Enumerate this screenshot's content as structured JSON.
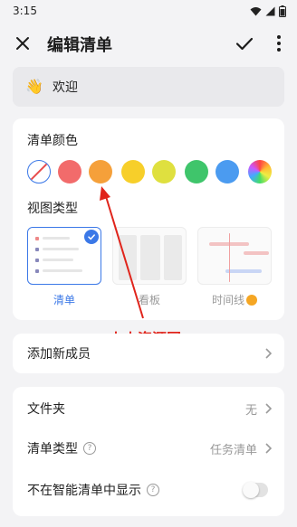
{
  "status_bar": {
    "time": "3:15"
  },
  "app_bar": {
    "title": "编辑清单"
  },
  "name_field": {
    "emoji": "👋",
    "value": "欢迎"
  },
  "colors": {
    "label": "清单颜色",
    "swatches": [
      {
        "name": "none",
        "color": "#ffffff"
      },
      {
        "name": "red",
        "color": "#f26b6b"
      },
      {
        "name": "orange",
        "color": "#f5a03a"
      },
      {
        "name": "yellow",
        "color": "#f7cf2a"
      },
      {
        "name": "lime",
        "color": "#dfe03f"
      },
      {
        "name": "green",
        "color": "#3fc56b"
      },
      {
        "name": "blue",
        "color": "#4b9bf0"
      },
      {
        "name": "rainbow",
        "color": "conic"
      }
    ],
    "selected": "none"
  },
  "view_type": {
    "label": "视图类型",
    "options": [
      {
        "label": "清单",
        "selected": true
      },
      {
        "label": "看板",
        "selected": false
      },
      {
        "label": "时间线",
        "selected": false,
        "premium": true
      }
    ]
  },
  "watermark": "火火资源网",
  "member": {
    "label": "添加新成员"
  },
  "settings": {
    "folder": {
      "label": "文件夹",
      "value": "无"
    },
    "list_type": {
      "label": "清单类型",
      "value": "任务清单"
    },
    "hide_smart": {
      "label": "不在智能清单中显示",
      "enabled": false
    }
  },
  "accent_color": "#3b78e7"
}
